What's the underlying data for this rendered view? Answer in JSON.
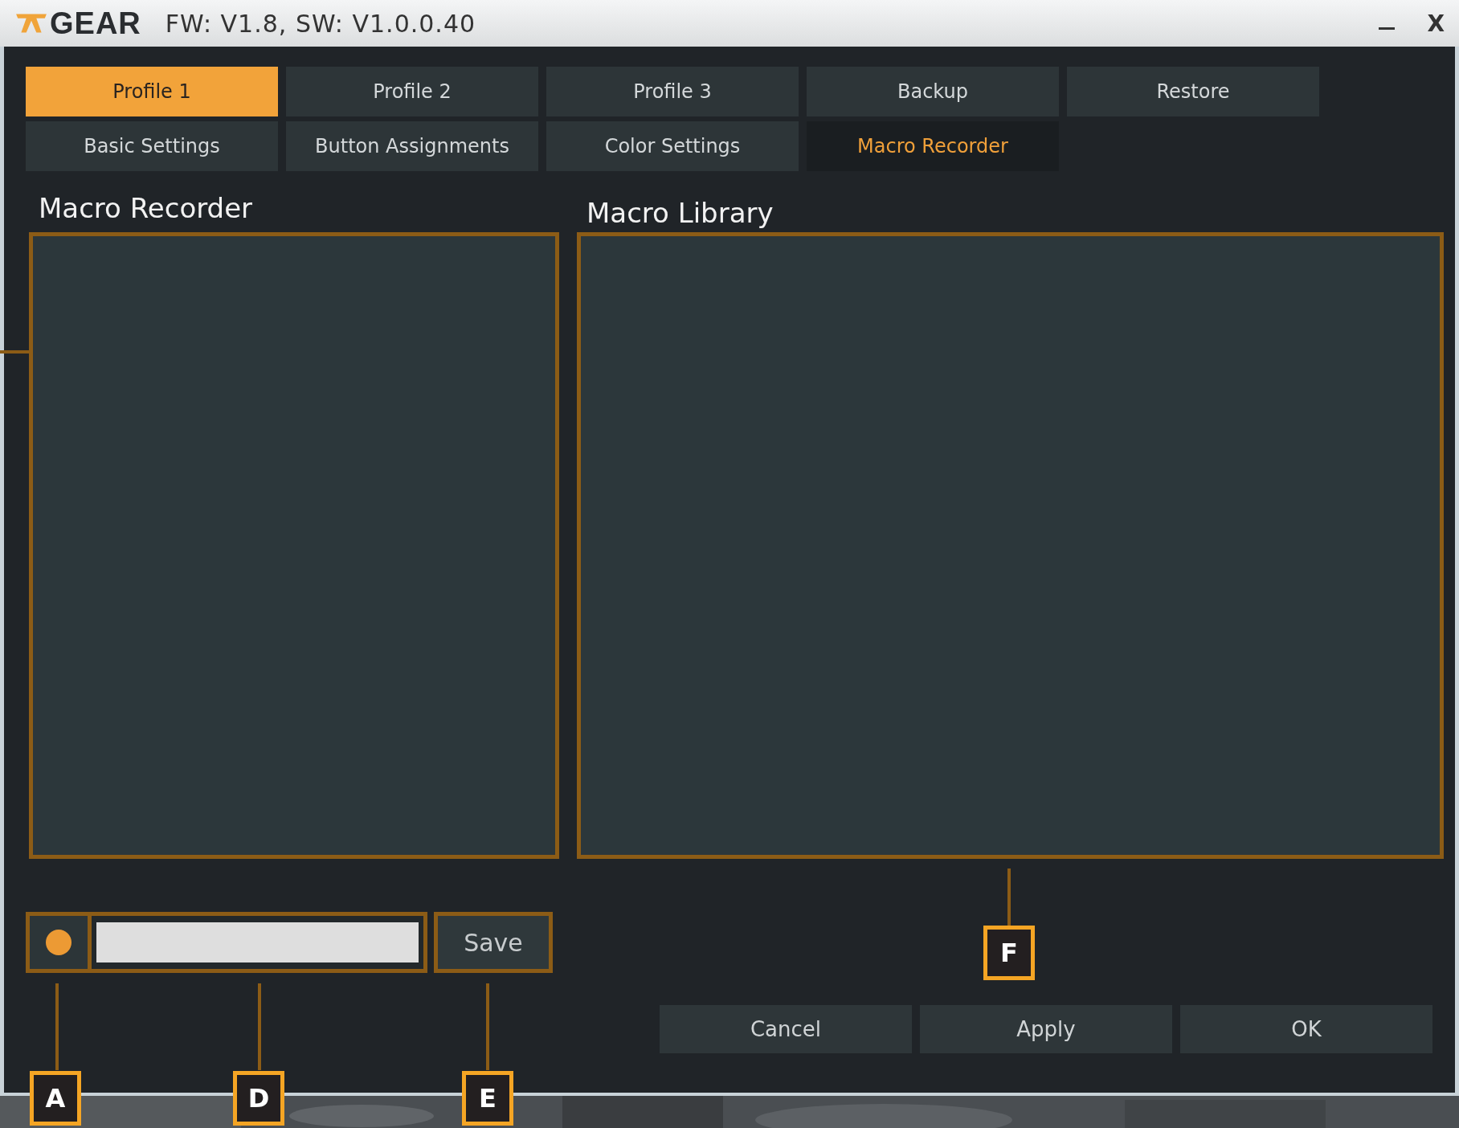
{
  "window": {
    "brand": "GEAR",
    "title": "FW: V1.8, SW: V1.0.0.40",
    "close": "X"
  },
  "profile_tabs": [
    {
      "label": "Profile 1",
      "selected": true
    },
    {
      "label": "Profile 2",
      "selected": false
    },
    {
      "label": "Profile 3",
      "selected": false
    },
    {
      "label": "Backup",
      "selected": false
    },
    {
      "label": "Restore",
      "selected": false
    }
  ],
  "section_tabs": [
    {
      "label": "Basic Settings",
      "selected": false
    },
    {
      "label": "Button Assignments",
      "selected": false
    },
    {
      "label": "Color Settings",
      "selected": false
    },
    {
      "label": "Macro Recorder",
      "selected": true
    }
  ],
  "recorder": {
    "title": "Macro Recorder",
    "save_button": "Save"
  },
  "library": {
    "title": "Macro Library"
  },
  "buttons": [
    "Cancel",
    "Apply",
    "OK"
  ],
  "callouts": [
    "A",
    "D",
    "E",
    "F"
  ]
}
